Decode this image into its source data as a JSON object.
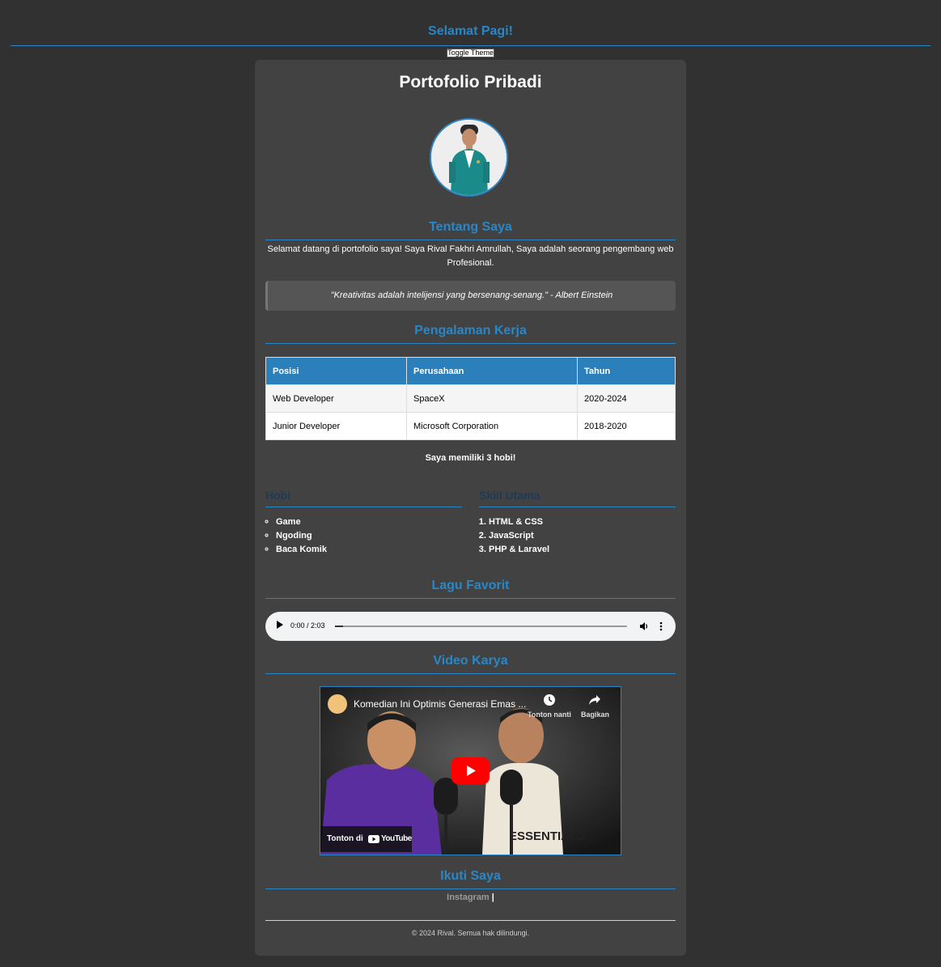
{
  "header": {
    "greeting": "Selamat Pagi!",
    "toggle_label": "Toggle Theme"
  },
  "profile": {
    "title": "Portofolio Pribadi"
  },
  "about": {
    "heading": "Tentang Saya",
    "text": "Selamat datang di portofolio saya! Saya Rival Fakhri Amrullah, Saya adalah seorang pengembang web Profesional.",
    "quote": "\"Kreativitas adalah intelijensi yang bersenang-senang.\" - Albert Einstein"
  },
  "experience": {
    "heading": "Pengalaman Kerja",
    "columns": [
      "Posisi",
      "Perusahaan",
      "Tahun"
    ],
    "rows": [
      [
        "Web Developer",
        "SpaceX",
        "2020-2024"
      ],
      [
        "Junior Developer",
        "Microsoft Corporation",
        "2018-2020"
      ]
    ]
  },
  "hobby_count": "Saya memiliki 3 hobi!",
  "hobbies": {
    "heading": "Hobi",
    "items": [
      "Game",
      "Ngoding",
      "Baca Komik"
    ]
  },
  "skills": {
    "heading": "Skill Utama",
    "items": [
      "HTML & CSS",
      "JavaScript",
      "PHP & Laravel"
    ]
  },
  "music": {
    "heading": "Lagu Favorit",
    "time": "0:00 / 2:03"
  },
  "video": {
    "heading": "Video Karya",
    "title": "Komedian Ini Optimis Generasi Emas ...",
    "watch_later": "Tonton nanti",
    "share": "Bagikan",
    "watch_on": "Tonton di",
    "platform": "YouTube",
    "hoodie_text": "ESSENTIALS"
  },
  "social": {
    "heading": "Ikuti Saya",
    "link": "Instagram",
    "separator": "|"
  },
  "footer": {
    "text": "© 2024 Rival. Semua hak dilindungi."
  },
  "colors": {
    "accent": "#2b86c5",
    "background": "#313131",
    "card": "#424242"
  }
}
